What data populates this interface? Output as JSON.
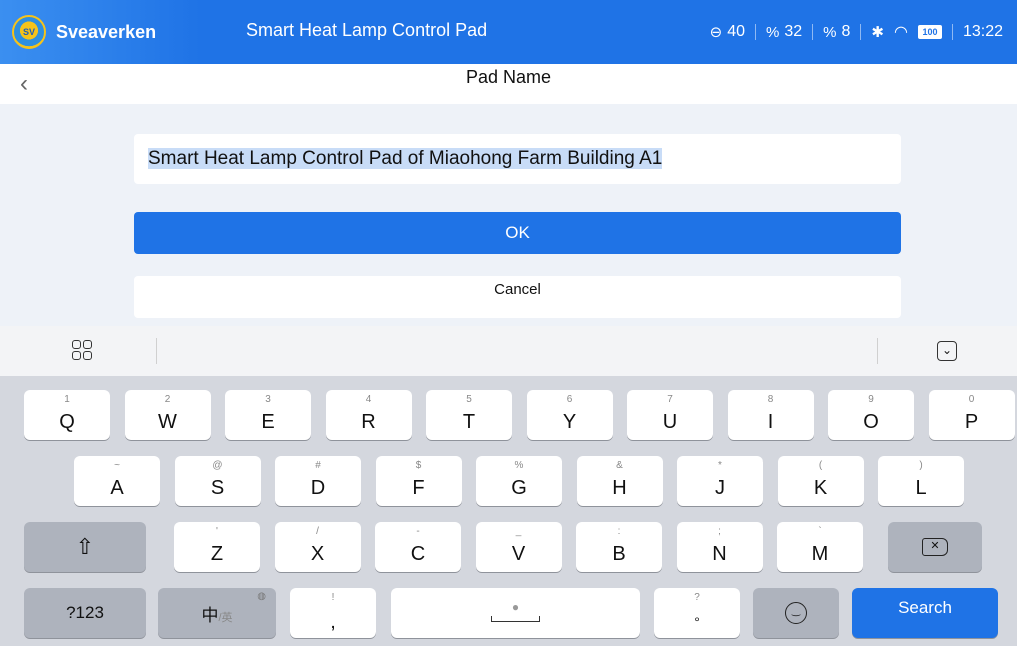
{
  "status_bar": {
    "brand": "Sveaverken",
    "title": "Smart Heat Lamp Control Pad",
    "stat1": "40",
    "stat2": "32",
    "stat3": "8",
    "battery": "100",
    "time": "13:22"
  },
  "nav": {
    "back_icon": "chevron-left-icon",
    "title": "Pad Name"
  },
  "form": {
    "name_value": "Smart Heat Lamp Control Pad of Miaohong Farm Building A1",
    "ok_label": "OK",
    "cancel_label": "Cancel"
  },
  "keyboard": {
    "row1": [
      {
        "hint": "1",
        "key": "Q"
      },
      {
        "hint": "2",
        "key": "W"
      },
      {
        "hint": "3",
        "key": "E"
      },
      {
        "hint": "4",
        "key": "R"
      },
      {
        "hint": "5",
        "key": "T"
      },
      {
        "hint": "6",
        "key": "Y"
      },
      {
        "hint": "7",
        "key": "U"
      },
      {
        "hint": "8",
        "key": "I"
      },
      {
        "hint": "9",
        "key": "O"
      },
      {
        "hint": "0",
        "key": "P"
      }
    ],
    "row2": [
      {
        "hint": "~",
        "key": "A"
      },
      {
        "hint": "@",
        "key": "S"
      },
      {
        "hint": "#",
        "key": "D"
      },
      {
        "hint": "$",
        "key": "F"
      },
      {
        "hint": "%",
        "key": "G"
      },
      {
        "hint": "&",
        "key": "H"
      },
      {
        "hint": "*",
        "key": "J"
      },
      {
        "hint": "(",
        "key": "K"
      },
      {
        "hint": ")",
        "key": "L"
      }
    ],
    "row3": [
      {
        "hint": "'",
        "key": "Z"
      },
      {
        "hint": "/",
        "key": "X"
      },
      {
        "hint": "-",
        "key": "C"
      },
      {
        "hint": "_",
        "key": "V"
      },
      {
        "hint": ":",
        "key": "B"
      },
      {
        "hint": ";",
        "key": "N"
      },
      {
        "hint": "`",
        "key": "M"
      }
    ],
    "numeric_label": "?123",
    "lang_main": "中",
    "lang_sub": "/英",
    "comma_hint": "!",
    "comma_key": ",",
    "period_hint": "?",
    "period_key": "°",
    "search_label": "Search"
  }
}
